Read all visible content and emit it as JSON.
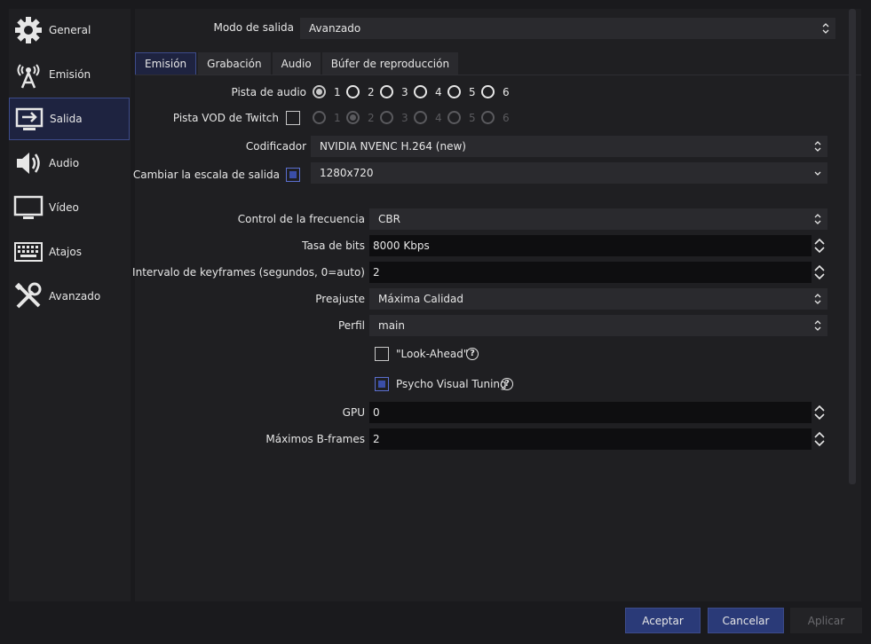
{
  "sidebar": {
    "items": [
      {
        "label": "General",
        "icon": "gear-icon"
      },
      {
        "label": "Emisión",
        "icon": "broadcast-icon"
      },
      {
        "label": "Salida",
        "icon": "output-icon",
        "active": true
      },
      {
        "label": "Audio",
        "icon": "speaker-icon"
      },
      {
        "label": "Vídeo",
        "icon": "monitor-icon"
      },
      {
        "label": "Atajos",
        "icon": "keyboard-icon"
      },
      {
        "label": "Avanzado",
        "icon": "tools-icon"
      }
    ]
  },
  "output": {
    "mode_label": "Modo de salida",
    "mode_value": "Avanzado"
  },
  "tabs": [
    "Emisión",
    "Grabación",
    "Audio",
    "Búfer de reproducción"
  ],
  "audio_track": {
    "label": "Pista de audio",
    "options": [
      "1",
      "2",
      "3",
      "4",
      "5",
      "6"
    ],
    "selected": "1"
  },
  "twitch_vod": {
    "label": "Pista VOD de Twitch",
    "options": [
      "1",
      "2",
      "3",
      "4",
      "5",
      "6"
    ],
    "selected": "2"
  },
  "encoder": {
    "label": "Codificador",
    "value": "NVIDIA NVENC H.264 (new)"
  },
  "rescale": {
    "label": "Cambiar la escala de salida",
    "value": "1280x720"
  },
  "rate_control": {
    "label": "Control de la frecuencia",
    "value": "CBR"
  },
  "bitrate": {
    "label": "Tasa de bits",
    "value": "8000 Kbps"
  },
  "keyframe": {
    "label": "Intervalo de keyframes (segundos, 0=auto)",
    "value": "2"
  },
  "preset": {
    "label": "Preajuste",
    "value": "Máxima Calidad"
  },
  "profile": {
    "label": "Perfil",
    "value": "main"
  },
  "look_ahead": {
    "label": "\"Look-Ahead\"",
    "checked": false
  },
  "psycho_visual": {
    "label": "Psycho Visual Tuning",
    "checked": true
  },
  "help_glyph": "?",
  "gpu": {
    "label": "GPU",
    "value": "0"
  },
  "bframes": {
    "label": "Máximos B-frames",
    "value": "2"
  },
  "buttons": {
    "accept": "Aceptar",
    "cancel": "Cancelar",
    "apply": "Aplicar"
  },
  "colors": {
    "accent": "#3d4b8a",
    "active_bg": "#1e2340",
    "panel": "#1f1f22"
  }
}
